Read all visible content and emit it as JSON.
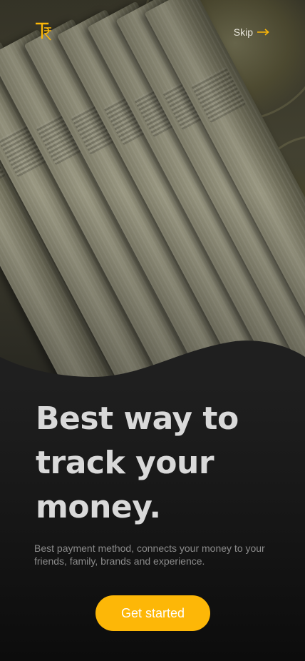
{
  "header": {
    "logo_icon": "rupee-t-logo",
    "skip_label": "Skip",
    "skip_icon": "arrow-right-icon"
  },
  "hero": {
    "image": "indian-currency-notes-and-coins"
  },
  "content": {
    "headline_lines": [
      "Best way to",
      "track your",
      "money."
    ],
    "subtitle": "Best payment method, connects your money to your friends, family, brands and experience.",
    "cta_label": "Get started"
  },
  "colors": {
    "accent": "#fdb707",
    "headline": "#d9d9d9",
    "subtitle": "#8b8b8b",
    "background": "#0f0f0f"
  }
}
